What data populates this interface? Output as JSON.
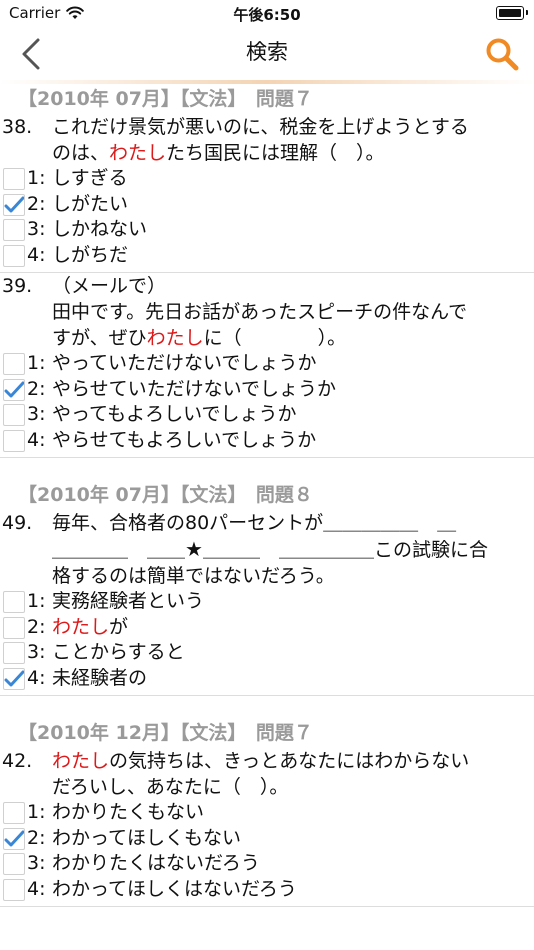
{
  "status_bar": {
    "carrier": "Carrier",
    "time": "午後6:50"
  },
  "nav": {
    "title": "検索",
    "back_icon": "chevron-left-icon",
    "search_icon": "search-icon",
    "accent_color": "#f08a24"
  },
  "colors": {
    "highlight": "#dd1a1a",
    "check": "#3a86d6",
    "section_header": "#9a9a9a"
  },
  "sections": [
    {
      "header": "【2010年 07月】【文法】　問題７",
      "questions": [
        {
          "number": "38.",
          "lines": [
            [
              {
                "t": "これだけ景気が悪いのに、税金を上げようとする"
              }
            ],
            [
              {
                "t": "のは、"
              },
              {
                "t": "わたし",
                "hl": true
              },
              {
                "t": "たち国民には理解（　）。"
              }
            ]
          ],
          "options": [
            {
              "num": "1:",
              "text": "しすぎる",
              "checked": false
            },
            {
              "num": "2:",
              "text": "しがたい",
              "checked": true
            },
            {
              "num": "3:",
              "text": "しかねない",
              "checked": false
            },
            {
              "num": "4:",
              "text": "しがちだ",
              "checked": false
            }
          ]
        },
        {
          "number": "39.",
          "lines": [
            [
              {
                "t": "（メールで）"
              }
            ],
            [
              {
                "t": "田中です。先日お話があったスピーチの件なんで"
              }
            ],
            [
              {
                "t": "すが、ぜひ"
              },
              {
                "t": "わたし",
                "hl": true
              },
              {
                "t": "に（　　　　）。"
              }
            ]
          ],
          "options": [
            {
              "num": "1:",
              "text": "やっていただけないでしょうか",
              "checked": false
            },
            {
              "num": "2:",
              "text": "やらせていただけないでしょうか",
              "checked": true
            },
            {
              "num": "3:",
              "text": "やってもよろしいでしょうか",
              "checked": false
            },
            {
              "num": "4:",
              "text": "やらせてもよろしいでしょうか",
              "checked": false
            }
          ]
        }
      ]
    },
    {
      "header": "【2010年 07月】【文法】　問題８",
      "questions": [
        {
          "number": "49.",
          "lines": [
            [
              {
                "t": "毎年、合格者の80パーセントが＿＿＿＿＿　＿"
              }
            ],
            [
              {
                "t": "＿＿＿＿　＿＿★＿＿＿　＿＿＿＿＿この試験に合"
              }
            ],
            [
              {
                "t": "格するのは簡単ではないだろう。"
              }
            ]
          ],
          "options": [
            {
              "num": "1:",
              "text": "実務経験者という",
              "checked": false
            },
            {
              "num": "2:",
              "text": "わたしが",
              "hl_prefix": "わたし",
              "checked": false
            },
            {
              "num": "3:",
              "text": "ことからすると",
              "checked": false
            },
            {
              "num": "4:",
              "text": "未経験者の",
              "checked": true
            }
          ]
        }
      ]
    },
    {
      "header": "【2010年 12月】【文法】　問題７",
      "questions": [
        {
          "number": "42.",
          "lines": [
            [
              {
                "t": "わたし",
                "hl": true
              },
              {
                "t": "の気持ちは、きっとあなたにはわからない"
              }
            ],
            [
              {
                "t": "だろいし、あなたに（　）。"
              }
            ]
          ],
          "options": [
            {
              "num": "1:",
              "text": "わかりたくもない",
              "checked": false
            },
            {
              "num": "2:",
              "text": "わかってほしくもない",
              "checked": true
            },
            {
              "num": "3:",
              "text": "わかりたくはないだろう",
              "checked": false
            },
            {
              "num": "4:",
              "text": "わかってほしくはないだろう",
              "checked": false
            }
          ]
        }
      ]
    }
  ]
}
